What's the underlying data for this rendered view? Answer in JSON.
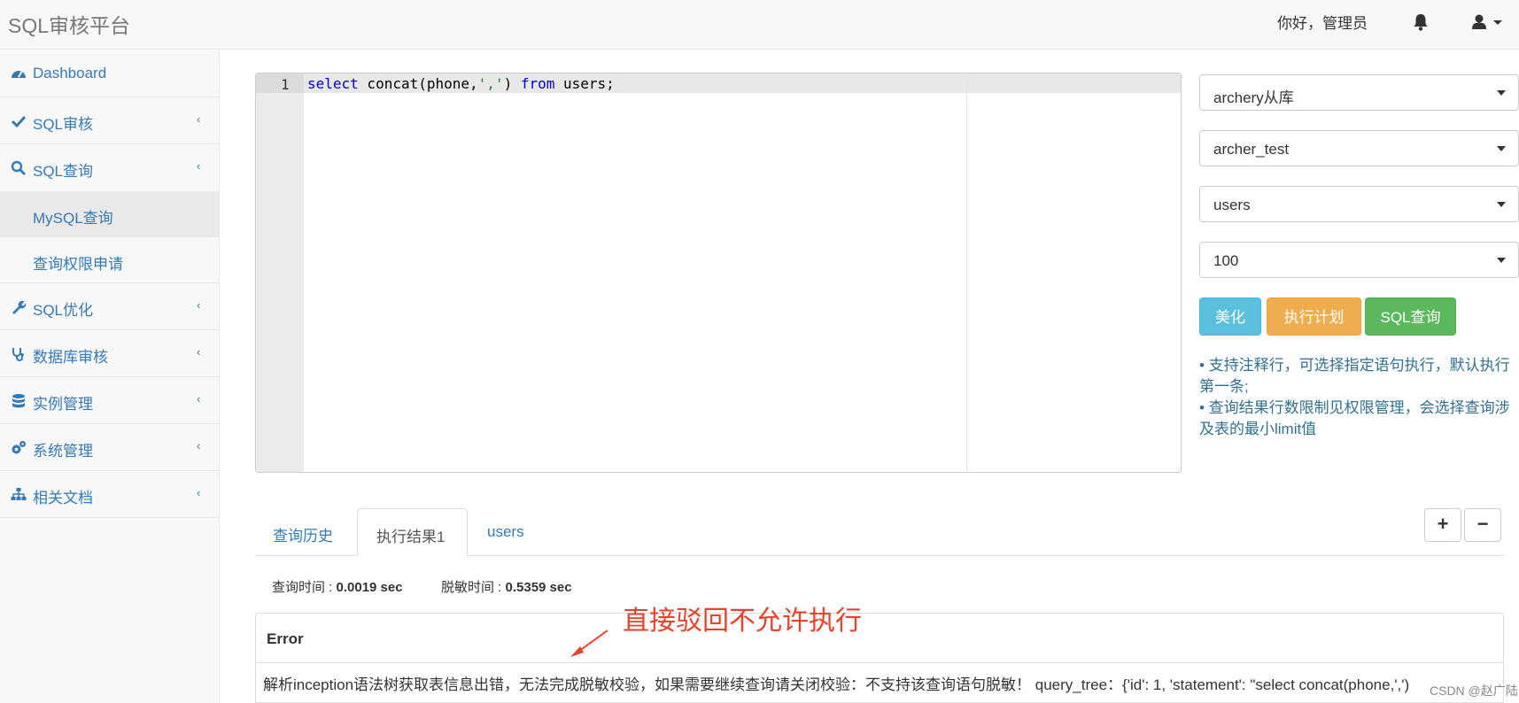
{
  "header": {
    "brand": "SQL审核平台",
    "greeting": "你好，管理员"
  },
  "sidebar": {
    "items": [
      {
        "label": "Dashboard",
        "icon": "dashboard-icon"
      },
      {
        "label": "SQL审核",
        "icon": "check-icon"
      },
      {
        "label": "SQL查询",
        "icon": "search-icon"
      },
      {
        "label": "MySQL查询"
      },
      {
        "label": "查询权限申请"
      },
      {
        "label": "SQL优化",
        "icon": "wrench-icon"
      },
      {
        "label": "数据库审核",
        "icon": "stethoscope-icon"
      },
      {
        "label": "实例管理",
        "icon": "database-icon"
      },
      {
        "label": "系统管理",
        "icon": "gears-icon"
      },
      {
        "label": "相关文档",
        "icon": "sitemap-icon"
      }
    ]
  },
  "editor": {
    "line_number": "1",
    "code_select": "select",
    "code_mid": " concat(phone,",
    "code_str": "','",
    "code_close": ")",
    "code_from": "from",
    "code_tail": " users;"
  },
  "right_panel": {
    "instance": "archery从库",
    "database": "archer_test",
    "table": "users",
    "limit": "100",
    "btn_beautify": "美化",
    "btn_explain": "执行计划",
    "btn_query": "SQL查询",
    "tip1": "•   支持注释行，可选择指定语句执行，默认执行第一条;",
    "tip2": "•   查询结果行数限制见权限管理，会选择查询涉及表的最小limit值"
  },
  "tabs": [
    {
      "label": "查询历史"
    },
    {
      "label": "执行结果1"
    },
    {
      "label": "users"
    }
  ],
  "meta": {
    "query_time_label": "查询时间 : ",
    "query_time": "0.0019 sec",
    "mask_time_label": "脱敏时间 : ",
    "mask_time": "0.5359 sec"
  },
  "result": {
    "header": "Error",
    "message": "解析inception语法树获取表信息出错，无法完成脱敏校验，如果需要继续查询请关闭校验：不支持该查询语句脱敏！ query_tree：{'id': 1, 'statement': \"select concat(phone,',')"
  },
  "annotation": "直接驳回不允许执行",
  "watermark": "CSDN @赵广陆",
  "colors": {
    "link": "#337ab7",
    "info": "#5bc0de",
    "warning": "#f0ad4e",
    "success": "#5cb85c",
    "annotation": "#e8412c"
  }
}
